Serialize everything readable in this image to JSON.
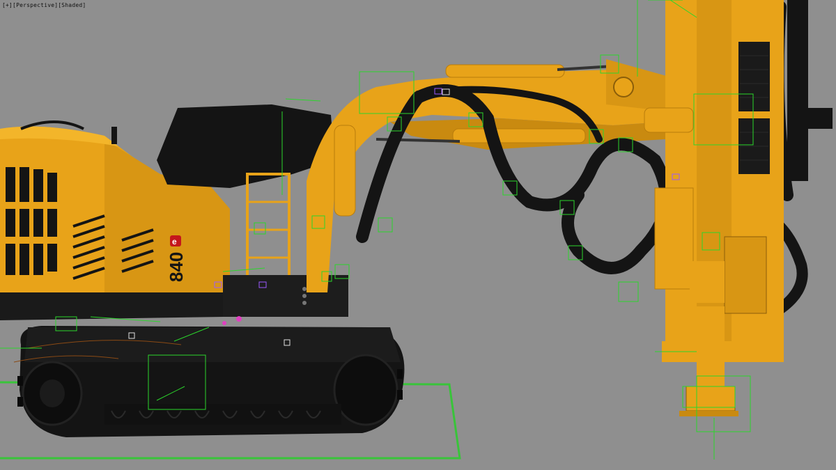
{
  "viewport": {
    "label": "[+][Perspective][Shaded]"
  },
  "model": {
    "badge": "840",
    "badge_suffix": "e"
  },
  "colors": {
    "background": "#8f8f8f",
    "body_yellow": "#e8a319",
    "body_shadow": "#b97c0c",
    "black_part": "#141414",
    "helper_green": "#2bd62b",
    "grid_green": "#39c43a"
  },
  "icons": {
    "gizmo": "transform-gizmo-icon"
  }
}
